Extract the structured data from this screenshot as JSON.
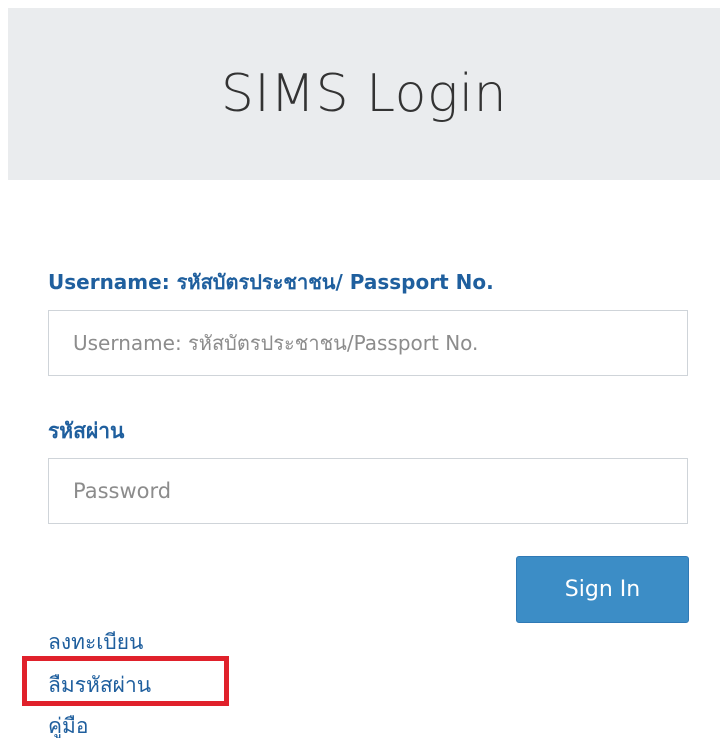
{
  "header": {
    "title": "SIMS Login"
  },
  "form": {
    "username_label": "Username: รหัสบัตรประชาชน/ Passport No.",
    "username_placeholder": "Username: รหัสบัตรประชาชน/Passport No.",
    "username_value": "",
    "password_label": "รหัสผ่าน",
    "password_placeholder": "Password",
    "password_value": "",
    "signin_label": "Sign In"
  },
  "links": {
    "register": "ลงทะเบียน",
    "forgot_password": "ลืมรหัสผ่าน",
    "manual": "คู่มือ"
  },
  "colors": {
    "header_bg": "#eaecee",
    "accent": "#1f5f9e",
    "button_bg": "#3c8dc6",
    "highlight": "#e0212b"
  }
}
